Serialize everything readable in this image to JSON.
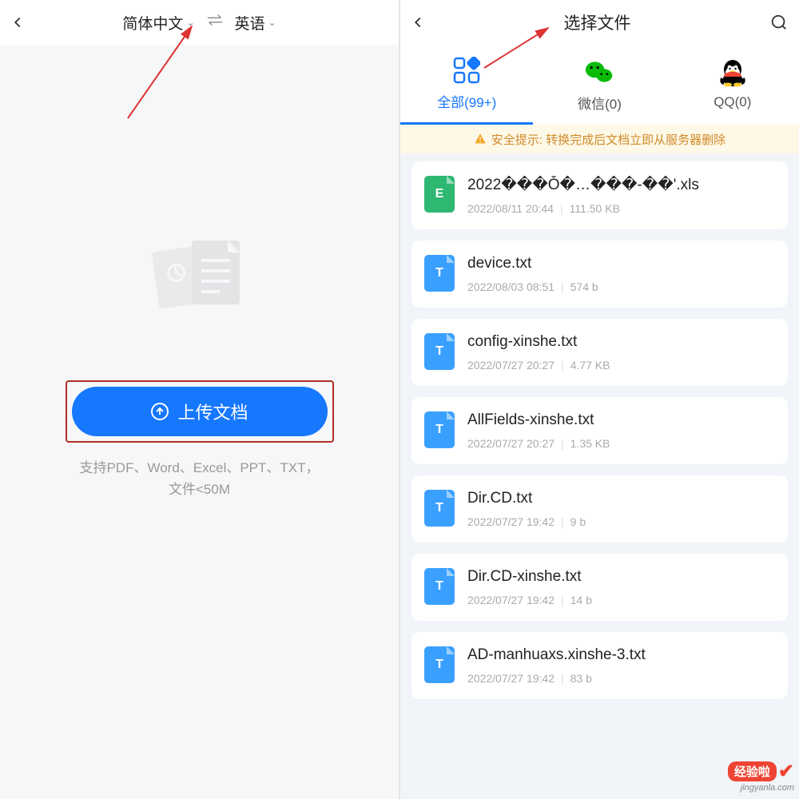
{
  "left": {
    "lang_from": "简体中文",
    "lang_to": "英语",
    "upload_label": "上传文档",
    "hint": "支持PDF、Word、Excel、PPT、TXT，\n文件<50M"
  },
  "right": {
    "title": "选择文件",
    "tabs": [
      {
        "label": "全部(99+)",
        "active": true,
        "icon": "grid"
      },
      {
        "label": "微信(0)",
        "active": false,
        "icon": "wechat"
      },
      {
        "label": "QQ(0)",
        "active": false,
        "icon": "qq"
      }
    ],
    "warning": "安全提示: 转换完成后文档立即从服务器删除",
    "files": [
      {
        "name": "2022���Ǒ�…���-��'.xls",
        "date": "2022/08/11 20:44",
        "size": "111.50 KB",
        "type": "xls"
      },
      {
        "name": "device.txt",
        "date": "2022/08/03 08:51",
        "size": "574 b",
        "type": "txt"
      },
      {
        "name": "config-xinshe.txt",
        "date": "2022/07/27 20:27",
        "size": "4.77 KB",
        "type": "txt"
      },
      {
        "name": "AllFields-xinshe.txt",
        "date": "2022/07/27 20:27",
        "size": "1.35 KB",
        "type": "txt"
      },
      {
        "name": "Dir.CD.txt",
        "date": "2022/07/27 19:42",
        "size": "9 b",
        "type": "txt"
      },
      {
        "name": "Dir.CD-xinshe.txt",
        "date": "2022/07/27 19:42",
        "size": "14 b",
        "type": "txt"
      },
      {
        "name": "AD-manhuaxs.xinshe-3.txt",
        "date": "2022/07/27 19:42",
        "size": "83 b",
        "type": "txt"
      }
    ]
  },
  "watermark": {
    "badge": "经验啦",
    "url": "jingyanla.com"
  }
}
